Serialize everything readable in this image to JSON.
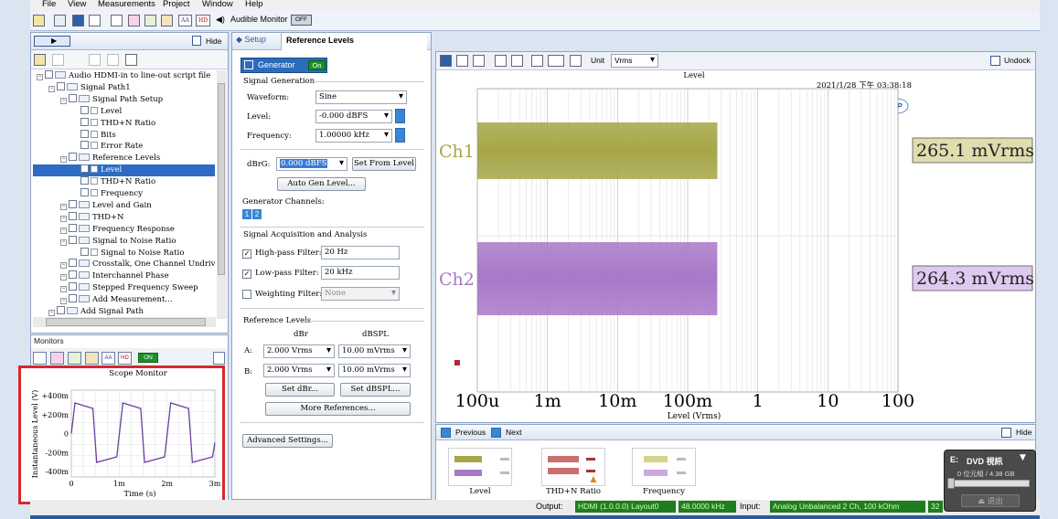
{
  "menu": {
    "file": "File",
    "view": "View",
    "measurements": "Measurements",
    "project": "Project",
    "window": "Window",
    "help": "Help"
  },
  "toolbar": {
    "audible_monitor": "Audible Monitor",
    "off_badge": "OFF",
    "hd_badge": "HD"
  },
  "left_panel": {
    "hide": "Hide"
  },
  "tree": [
    {
      "label": "Audio HDMI-in to line-out script file",
      "indent": 0
    },
    {
      "label": "Signal Path1",
      "indent": 1
    },
    {
      "label": "Signal Path Setup",
      "indent": 2
    },
    {
      "label": "Level",
      "indent": 3
    },
    {
      "label": "THD+N Ratio",
      "indent": 3
    },
    {
      "label": "Bits",
      "indent": 3
    },
    {
      "label": "Error Rate",
      "indent": 3
    },
    {
      "label": "Reference Levels",
      "indent": 2
    },
    {
      "label": "Level",
      "indent": 3,
      "selected": true
    },
    {
      "label": "THD+N Ratio",
      "indent": 3
    },
    {
      "label": "Frequency",
      "indent": 3
    },
    {
      "label": "Level and Gain",
      "indent": 2
    },
    {
      "label": "THD+N",
      "indent": 2
    },
    {
      "label": "Frequency Response",
      "indent": 2
    },
    {
      "label": "Signal to Noise Ratio",
      "indent": 2
    },
    {
      "label": "Signal to Noise Ratio",
      "indent": 3
    },
    {
      "label": "Crosstalk, One Channel Undriven",
      "indent": 2
    },
    {
      "label": "Interchannel Phase",
      "indent": 2
    },
    {
      "label": "Stepped Frequency Sweep",
      "indent": 2
    },
    {
      "label": "Add Measurement...",
      "indent": 2
    },
    {
      "label": "Add Signal Path",
      "indent": 1
    }
  ],
  "monitors": {
    "title": "Monitors",
    "scope_title": "Scope Monitor",
    "on_badge": "ON",
    "ylabel": "Instantaneous Level (V)",
    "xlabel": "Time (s)",
    "yticks": [
      "+400m",
      "+200m",
      "0",
      "-200m",
      "-400m"
    ],
    "xticks": [
      "0",
      "1m",
      "2m",
      "3m"
    ]
  },
  "tabs": {
    "setup": "Setup",
    "reference_levels": "Reference Levels"
  },
  "generator": {
    "button": "Generator",
    "on": "On",
    "section": "Signal Generation",
    "waveform_label": "Waveform:",
    "waveform": "Sine",
    "level_label": "Level:",
    "level": "-0.000 dBFS",
    "freq_label": "Frequency:",
    "freq": "1.00000 kHz",
    "dbrg_label": "dBrG:",
    "dbrg": "0.000 dBFS",
    "set_from_level": "Set From Level",
    "auto_gen": "Auto Gen Level...",
    "channels_label": "Generator Channels:",
    "ch1": "1",
    "ch2": "2"
  },
  "acquisition": {
    "section": "Signal Acquisition and Analysis",
    "hp_label": "High-pass Filter:",
    "hp": "20 Hz",
    "lp_label": "Low-pass Filter:",
    "lp": "20 kHz",
    "w_label": "Weighting Filter:",
    "w": "None"
  },
  "reference": {
    "section": "Reference Levels",
    "col_dbr": "dBr",
    "col_dbspl": "dBSPL",
    "row_a": "A:",
    "row_b": "B:",
    "a_dbr": "2.000 Vrms",
    "a_dbspl": "10.00 mVrms",
    "b_dbr": "2.000 Vrms",
    "b_dbspl": "10.00 mVrms",
    "set_dbr": "Set dBr...",
    "set_dbspl": "Set dBSPL...",
    "more": "More References...",
    "advanced": "Advanced Settings..."
  },
  "graph_toolbar": {
    "unit_label": "Unit",
    "unit": "Vrms",
    "undock": "Undock"
  },
  "chart_data": {
    "type": "bar",
    "orientation": "horizontal",
    "title": "Level",
    "timestamp": "2021/1/28 下午 03:38:18",
    "xlabel": "Level (Vrms)",
    "xscale": "log",
    "xticks": [
      "100u",
      "1m",
      "10m",
      "100m",
      "1",
      "10",
      "100"
    ],
    "xlim": [
      0.0001,
      100
    ],
    "categories": [
      "Ch1",
      "Ch2"
    ],
    "values": [
      0.2651,
      0.2643
    ],
    "value_labels": [
      "265.1 mVrms",
      "264.3 mVrms"
    ],
    "colors": [
      "#a6a647",
      "#a978c8"
    ]
  },
  "nav": {
    "previous": "Previous",
    "next": "Next",
    "hide": "Hide"
  },
  "thumbs": [
    {
      "label": "Level"
    },
    {
      "label": "THD+N Ratio"
    },
    {
      "label": "Frequency"
    }
  ],
  "statusbar": {
    "output_label": "Output:",
    "output": "HDMI (1.0.0.0) Layout0",
    "rate": "48.0000 kHz",
    "input_label": "Input:",
    "input": "Analog Unbalanced 2 Ch, 100 kOhm",
    "extra": "32"
  },
  "dvd": {
    "drive": "E:",
    "name": "DVD 視訊",
    "space": "0 位元組 / 4.38 GB",
    "eject": "退出"
  }
}
